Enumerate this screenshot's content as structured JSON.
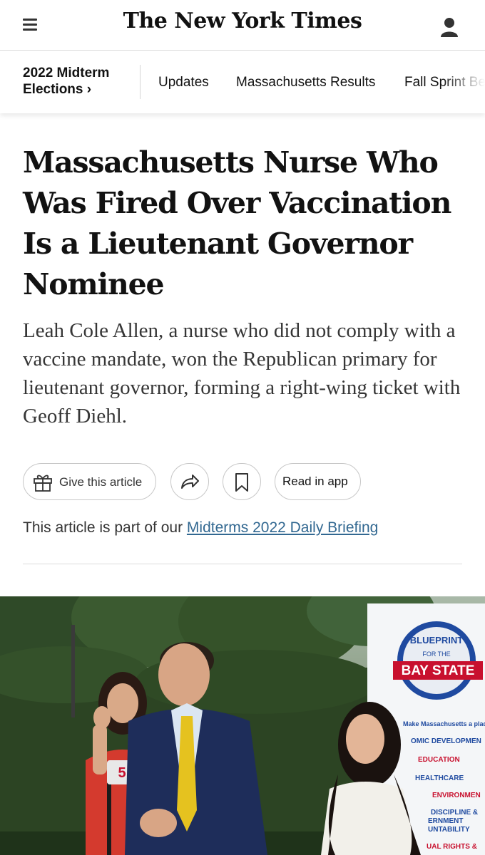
{
  "header": {
    "logo": "The New York Times",
    "menu_icon": "hamburger-menu-icon",
    "account_icon": "user-account-icon"
  },
  "section_nav": {
    "title": "2022 Midterm Elections ›",
    "links": [
      "Updates",
      "Massachusetts Results",
      "Fall Sprint Be"
    ]
  },
  "article": {
    "headline": "Massachusetts Nurse Who Was Fired Over Vaccination Is a Lieutenant Governor Nominee",
    "summary": "Leah Cole Allen, a nurse who did not comply with a vaccine mandate, won the Republican primary for lieutenant governor, forming a right-wing ticket with Geoff Diehl."
  },
  "actions": {
    "gift_label": "Give this article",
    "read_in_app_label": "Read in app",
    "icons": [
      "gift-icon",
      "share-icon",
      "bookmark-icon"
    ]
  },
  "briefing": {
    "prefix": "This article is part of our ",
    "link_text": "Midterms 2022 Daily Briefing"
  },
  "photo": {
    "sign_title_top": "BLUEPRINT",
    "sign_title_mid": "FOR THE",
    "sign_title_main": "BAY STATE",
    "sign_tagline": "Make Massachusetts a place to",
    "sign_items": [
      "OMIC DEVELOPMEN",
      "EDUCATION",
      "HEALTHCARE",
      "ENVIRONMEN",
      "DISCIPLINE &",
      "ERNMENT",
      "UNTABILITY",
      "UAL RIGHTS &"
    ],
    "mic_label": "5"
  },
  "colors": {
    "link": "#326891",
    "text": "#121212",
    "summary_text": "#363636",
    "sign_red": "#c8102e",
    "sign_blue": "#1f4aa0"
  }
}
